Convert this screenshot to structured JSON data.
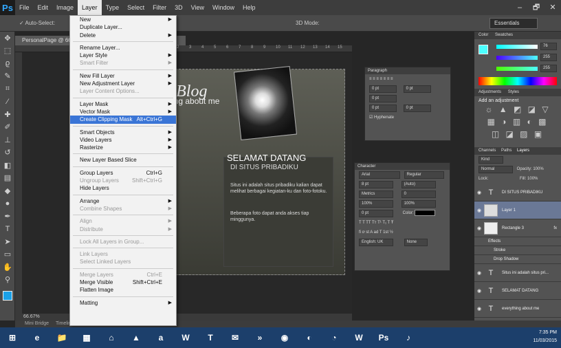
{
  "menubar": {
    "logo": "Ps",
    "items": [
      "File",
      "Edit",
      "Image",
      "Layer",
      "Type",
      "Select",
      "Filter",
      "3D",
      "View",
      "Window",
      "Help"
    ],
    "window_controls": [
      "–",
      "🗗",
      "✕"
    ]
  },
  "options": {
    "auto_select": "✓ Auto-Select:",
    "mode_3d": "3D Mode:",
    "workspace": "Essentials"
  },
  "document": {
    "tab": "PersonalPage @ 66.7% (Layer 1, RGB/8)",
    "zoom": "66.67%"
  },
  "ruler_ticks": [
    "2",
    "3",
    "4",
    "5",
    "6",
    "7",
    "8",
    "9",
    "10",
    "11",
    "12",
    "13",
    "14",
    "15"
  ],
  "canvas": {
    "blog_title": "e's Blog",
    "blog_subtitle": "ing about me",
    "welcome": "SELAMAT DATANG",
    "situs": "DI SITUS PRIBADIKU",
    "para1": "Situs ini adalah situs pribadiku kalian dapat melihat berbagai kegiatan-ku dan foto-fotoku.",
    "para2": "Beberapa foto dapat anda akses tiap minggunya."
  },
  "layer_menu": [
    {
      "label": "New",
      "arrow": true
    },
    {
      "label": "Duplicate Layer..."
    },
    {
      "label": "Delete",
      "arrow": true
    },
    {
      "sep": true
    },
    {
      "label": "Rename Layer..."
    },
    {
      "label": "Layer Style",
      "arrow": true
    },
    {
      "label": "Smart Filter",
      "arrow": true,
      "disabled": true
    },
    {
      "sep": true
    },
    {
      "label": "New Fill Layer",
      "arrow": true
    },
    {
      "label": "New Adjustment Layer",
      "arrow": true
    },
    {
      "label": "Layer Content Options...",
      "disabled": true
    },
    {
      "sep": true
    },
    {
      "label": "Layer Mask",
      "arrow": true
    },
    {
      "label": "Vector Mask",
      "arrow": true
    },
    {
      "label": "Create Clipping Mask",
      "shortcut": "Alt+Ctrl+G",
      "highlight": true
    },
    {
      "sep": true
    },
    {
      "label": "Smart Objects",
      "arrow": true
    },
    {
      "label": "Video Layers",
      "arrow": true
    },
    {
      "label": "Rasterize",
      "arrow": true
    },
    {
      "sep": true
    },
    {
      "label": "New Layer Based Slice"
    },
    {
      "sep": true
    },
    {
      "label": "Group Layers",
      "shortcut": "Ctrl+G"
    },
    {
      "label": "Ungroup Layers",
      "shortcut": "Shift+Ctrl+G",
      "disabled": true
    },
    {
      "label": "Hide Layers"
    },
    {
      "sep": true
    },
    {
      "label": "Arrange",
      "arrow": true
    },
    {
      "label": "Combine Shapes",
      "arrow": true,
      "disabled": true
    },
    {
      "sep": true
    },
    {
      "label": "Align",
      "arrow": true,
      "disabled": true
    },
    {
      "label": "Distribute",
      "arrow": true,
      "disabled": true
    },
    {
      "sep": true
    },
    {
      "label": "Lock All Layers in Group...",
      "disabled": true
    },
    {
      "sep": true
    },
    {
      "label": "Link Layers",
      "disabled": true
    },
    {
      "label": "Select Linked Layers",
      "disabled": true
    },
    {
      "sep": true
    },
    {
      "label": "Merge Layers",
      "shortcut": "Ctrl+E",
      "disabled": true
    },
    {
      "label": "Merge Visible",
      "shortcut": "Shift+Ctrl+E"
    },
    {
      "label": "Flatten Image"
    },
    {
      "sep": true
    },
    {
      "label": "Matting",
      "arrow": true
    }
  ],
  "paragraph": {
    "title": "Paragraph",
    "indent1": "0 pt",
    "indent2": "0 pt",
    "indent3": "0 pt",
    "space1": "0 pt",
    "space2": "0 pt",
    "hyphenate": "Hyphenate"
  },
  "character": {
    "title": "Character",
    "font": "Arial",
    "style": "Regular",
    "size": "8 pt",
    "leading": "(Auto)",
    "kerning": "Metrics",
    "tracking": "0",
    "vscale": "100%",
    "hscale": "100%",
    "baseline": "0 pt",
    "color_label": "Color:",
    "language": "English: UK",
    "aa": "None"
  },
  "color_panel": {
    "tab1": "Color",
    "tab2": "Swatches",
    "r": "76",
    "g": "255",
    "b": "255"
  },
  "adjust_panel": {
    "tab1": "Adjustments",
    "tab2": "Styles",
    "heading": "Add an adjustment"
  },
  "layers_panel": {
    "tabs": [
      "Channels",
      "Paths",
      "Layers"
    ],
    "kind": "Kind",
    "blend": "Normal",
    "opacity": "Opacity: 100%",
    "lock": "Lock:",
    "fill": "Fill: 100%",
    "layers": [
      {
        "name": "DI SITUS PRIBADIKU",
        "type": "T"
      },
      {
        "name": "Layer 1",
        "type": "img",
        "selected": true
      },
      {
        "name": "Rectangle 3",
        "type": "shape",
        "fx": "fx"
      },
      {
        "name": "Effects",
        "type": "sub"
      },
      {
        "name": "Stroke",
        "type": "sub2"
      },
      {
        "name": "Drop Shadow",
        "type": "sub2"
      },
      {
        "name": "Situs ini adalah situs pri...",
        "type": "T"
      },
      {
        "name": "SELAMAT DATANG",
        "type": "T"
      },
      {
        "name": "everything about me",
        "type": "T"
      }
    ]
  },
  "bridge": {
    "label": "Mini Bridge",
    "timeline": "Timeline"
  },
  "clock": {
    "time": "7:35 PM",
    "date": "11/03/2015"
  },
  "taskbar": [
    "⊞",
    "e",
    "📁",
    "▦",
    "⌂",
    "▲",
    "a",
    "W",
    "T",
    "✉",
    "»",
    "◉",
    "◐",
    "◔",
    "W",
    "Ps",
    "♪"
  ]
}
